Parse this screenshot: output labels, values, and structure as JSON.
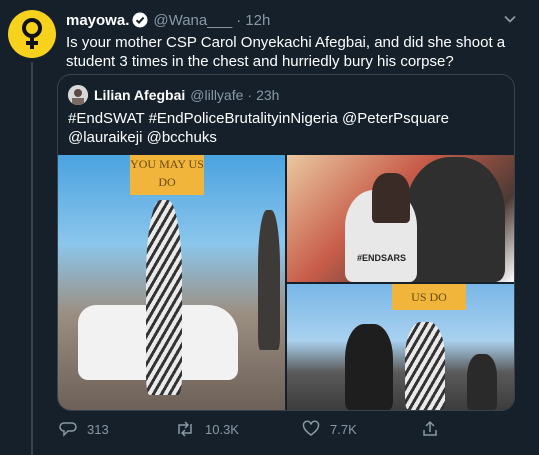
{
  "tweet": {
    "display_name": "mayowa.",
    "handle": "@Wana___",
    "time": "12h",
    "text": "Is your mother CSP Carol Onyekachi Afegbai, and did she shoot a student 3 times in the chest and hurriedly bury his corpse?",
    "avatar_icon": "female-symbol-icon",
    "accent_color": "#f7d21d"
  },
  "quoted": {
    "display_name": "Lilian Afegbai",
    "handle": "@lillyafe",
    "time": "23h",
    "text": "#EndSWAT #EndPoliceBrutalityinNigeria  @PeterPsquare @lauraikeji @bcchuks",
    "images": [
      {
        "desc": "woman-with-protest-sign-by-car",
        "sign_text": "YOU MAY US DO"
      },
      {
        "desc": "selfie-group-endsars",
        "shirt_text": "#ENDSARS"
      },
      {
        "desc": "two-women-with-protest-sign",
        "sign_text": "US DO"
      }
    ]
  },
  "actions": {
    "reply_count": "313",
    "retweet_count": "10.3K",
    "like_count": "7.7K"
  }
}
